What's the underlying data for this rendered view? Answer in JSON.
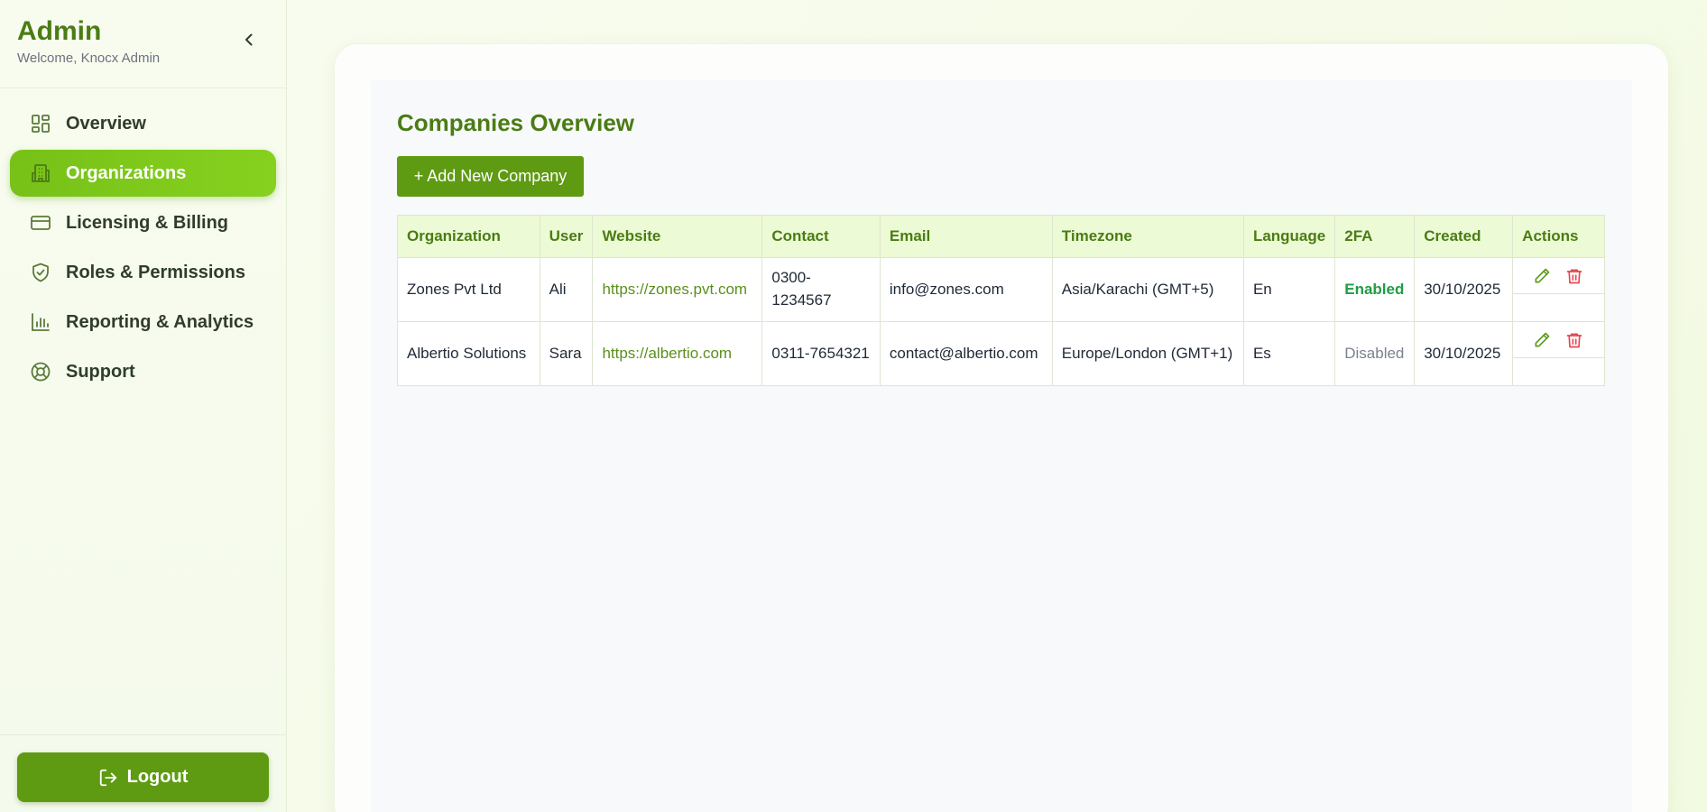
{
  "sidebar": {
    "title": "Admin",
    "subtitle": "Welcome, Knocx Admin",
    "items": [
      {
        "label": "Overview",
        "icon": "dashboard-grid-icon"
      },
      {
        "label": "Organizations",
        "icon": "building-icon",
        "active": true
      },
      {
        "label": "Licensing & Billing",
        "icon": "credit-card-icon"
      },
      {
        "label": "Roles & Permissions",
        "icon": "shield-check-icon"
      },
      {
        "label": "Reporting & Analytics",
        "icon": "bar-chart-icon"
      },
      {
        "label": "Support",
        "icon": "lifebuoy-icon"
      }
    ],
    "logout_label": "Logout"
  },
  "main": {
    "title": "Companies Overview",
    "add_button_label": "+ Add New Company",
    "table": {
      "columns": [
        "Organization",
        "User",
        "Website",
        "Contact",
        "Email",
        "Timezone",
        "Language",
        "2FA",
        "Created",
        "Actions"
      ],
      "rows": [
        {
          "organization": "Zones Pvt Ltd",
          "user": "Ali",
          "website": "https://zones.pvt.com",
          "contact": "0300-1234567",
          "email": "info@zones.com",
          "timezone": "Asia/Karachi (GMT+5)",
          "language": "En",
          "tfa": "Enabled",
          "created": "30/10/2025"
        },
        {
          "organization": "Albertio Solutions",
          "user": "Sara",
          "website": "https://albertio.com",
          "contact": "0311-7654321",
          "email": "contact@albertio.com",
          "timezone": "Europe/London (GMT+1)",
          "language": "Es",
          "tfa": "Disabled",
          "created": "30/10/2025"
        }
      ]
    }
  },
  "colors": {
    "brand": "#4a7c14",
    "accent": "#77c118",
    "button": "#5e9b12",
    "enabled": "#1f9d45",
    "delete": "#e5484d"
  }
}
